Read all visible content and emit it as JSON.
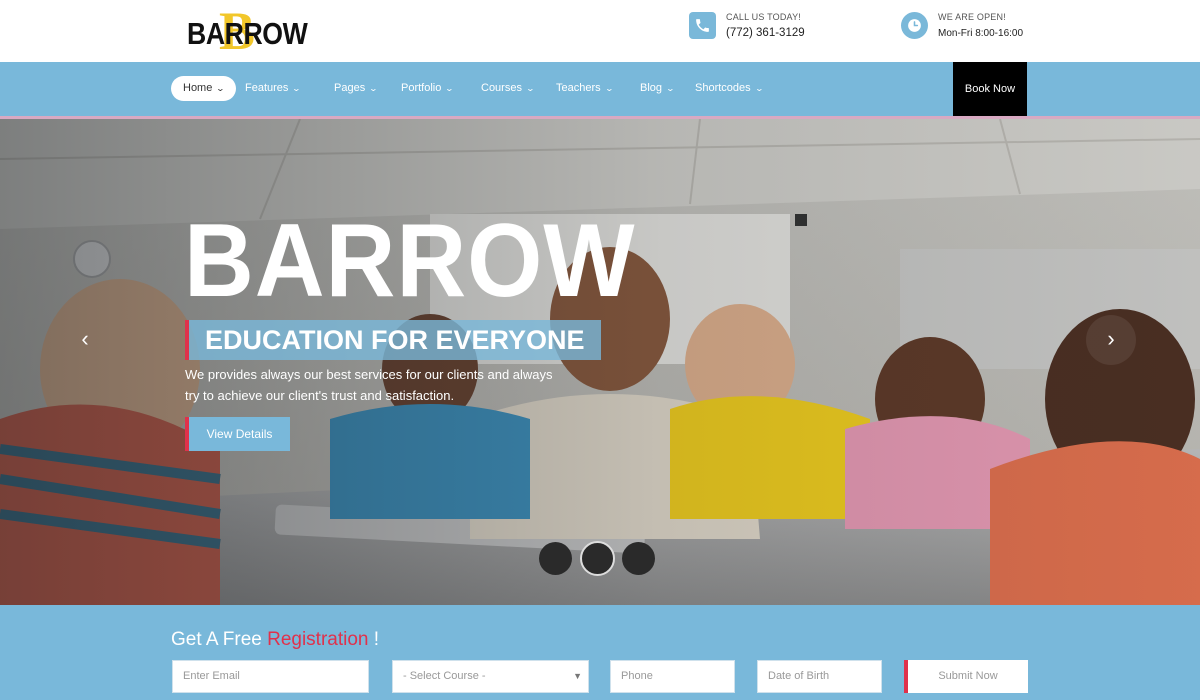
{
  "header": {
    "logo_text": "BARROW",
    "logo_letter": "B",
    "phone_label": "CALL US TODAY!",
    "phone_value": "(772) 361-3129",
    "hours_label": "WE ARE OPEN!",
    "hours_value": "Mon-Fri 8:00-16:00"
  },
  "nav": {
    "items": [
      {
        "label": "Home",
        "active": true
      },
      {
        "label": "Features"
      },
      {
        "label": "Pages"
      },
      {
        "label": "Portfolio"
      },
      {
        "label": "Courses"
      },
      {
        "label": "Teachers"
      },
      {
        "label": "Blog"
      },
      {
        "label": "Shortcodes"
      }
    ],
    "book_label": "Book Now",
    "chevron": "⌄"
  },
  "hero": {
    "title": "BARROW",
    "subtitle": "EDUCATION FOR EVERYONE",
    "text": "We provides always our best services for our clients and  always try to achieve our client's trust and satisfaction.",
    "button_label": "View Details",
    "prev_icon": "‹",
    "next_icon": "›",
    "slides_count": 3,
    "active_slide": 2
  },
  "registration": {
    "title_prefix": "Get A Free ",
    "title_accent": "Registration",
    "title_suffix": " !",
    "email_placeholder": "Enter Email",
    "course_placeholder": "- Select Course -",
    "phone_placeholder": "Phone",
    "dob_placeholder": "Date of Birth",
    "submit_label": "Submit Now"
  },
  "colors": {
    "accent_blue": "#79b8da",
    "accent_red": "#e0314b",
    "logo_gold": "#f2c72a"
  }
}
